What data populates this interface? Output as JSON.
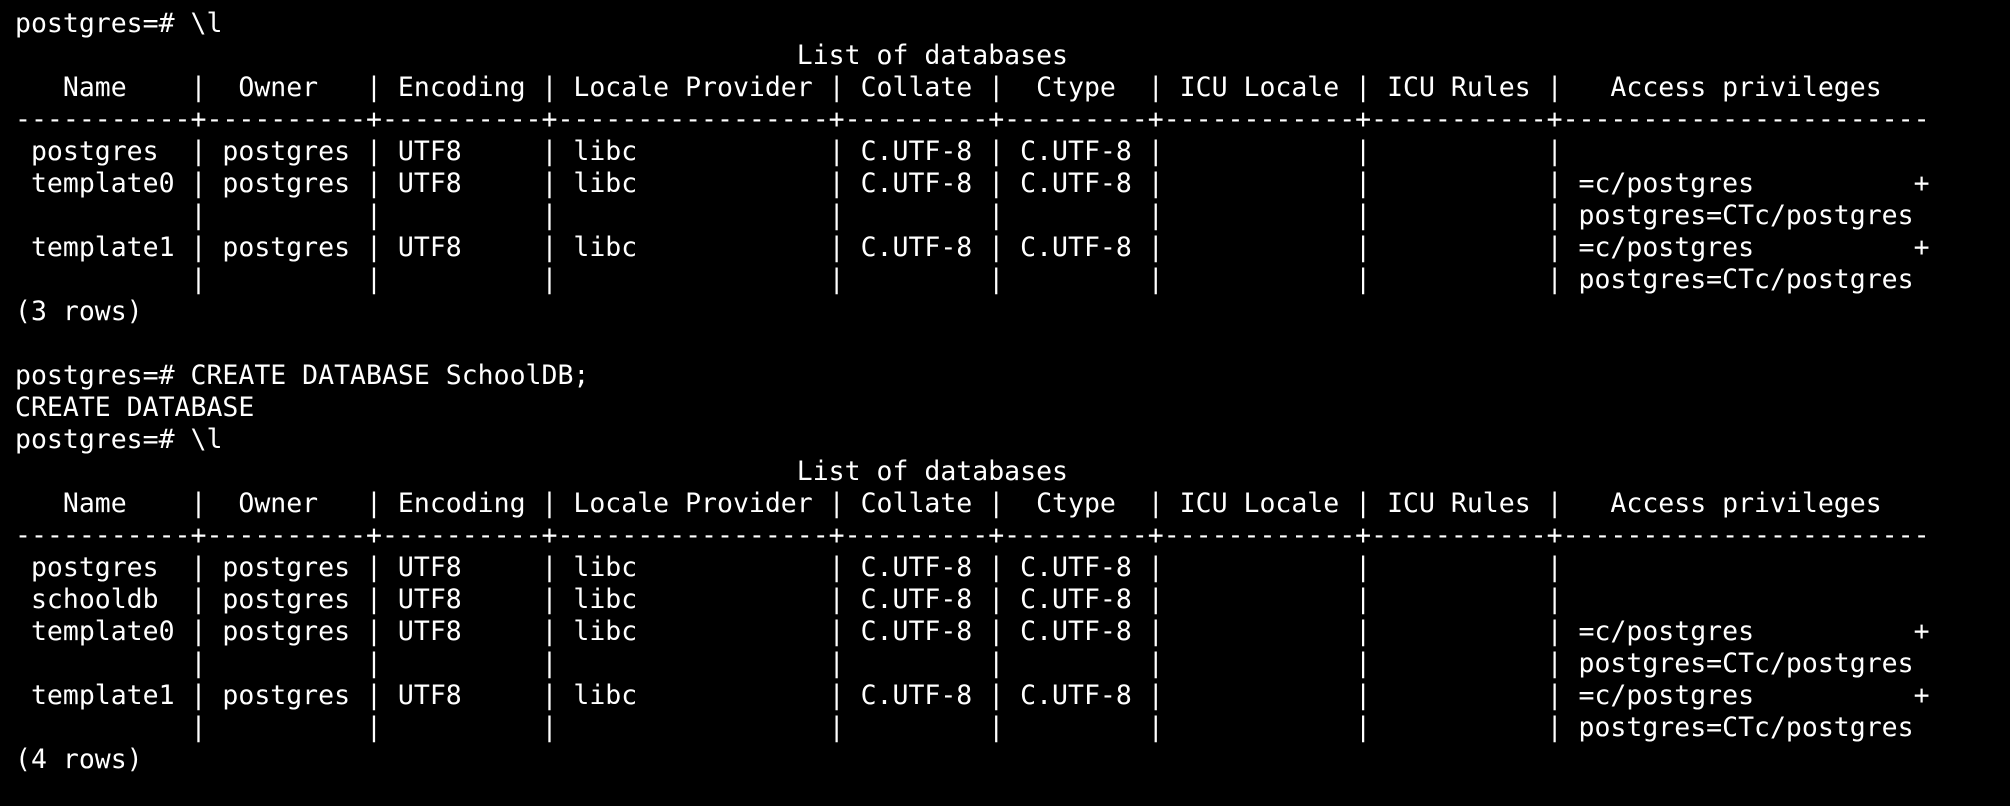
{
  "terminal": {
    "lines": [
      "postgres=# \\l",
      "                                                 List of databases",
      "   Name    |  Owner   | Encoding | Locale Provider | Collate |  Ctype  | ICU Locale | ICU Rules |   Access privileges",
      "-----------+----------+----------+-----------------+---------+---------+------------+-----------+-----------------------",
      " postgres  | postgres | UTF8     | libc            | C.UTF-8 | C.UTF-8 |            |           |",
      " template0 | postgres | UTF8     | libc            | C.UTF-8 | C.UTF-8 |            |           | =c/postgres          +",
      "           |          |          |                 |         |         |            |           | postgres=CTc/postgres",
      " template1 | postgres | UTF8     | libc            | C.UTF-8 | C.UTF-8 |            |           | =c/postgres          +",
      "           |          |          |                 |         |         |            |           | postgres=CTc/postgres",
      "(3 rows)",
      "",
      "postgres=# CREATE DATABASE SchoolDB;",
      "CREATE DATABASE",
      "postgres=# \\l",
      "                                                 List of databases",
      "   Name    |  Owner   | Encoding | Locale Provider | Collate |  Ctype  | ICU Locale | ICU Rules |   Access privileges",
      "-----------+----------+----------+-----------------+---------+---------+------------+-----------+-----------------------",
      " postgres  | postgres | UTF8     | libc            | C.UTF-8 | C.UTF-8 |            |           |",
      " schooldb  | postgres | UTF8     | libc            | C.UTF-8 | C.UTF-8 |            |           |",
      " template0 | postgres | UTF8     | libc            | C.UTF-8 | C.UTF-8 |            |           | =c/postgres          +",
      "           |          |          |                 |         |         |            |           | postgres=CTc/postgres",
      " template1 | postgres | UTF8     | libc            | C.UTF-8 | C.UTF-8 |            |           | =c/postgres          +",
      "           |          |          |                 |         |         |            |           | postgres=CTc/postgres",
      "(4 rows)"
    ]
  }
}
